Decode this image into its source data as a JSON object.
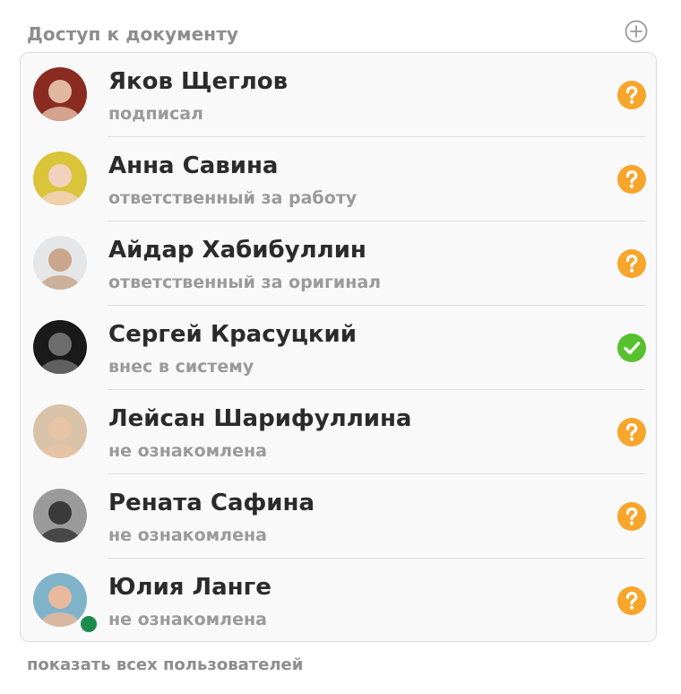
{
  "header": {
    "title": "Доступ к документу",
    "add_icon": "plus-circle-icon"
  },
  "members": [
    {
      "name": "Яков Щеглов",
      "role": "подписал",
      "status": "pending",
      "avatar_bg": "#8a2b22",
      "avatar_fg": "#e0b8a0"
    },
    {
      "name": "Анна Савина",
      "role": "ответственный за работу",
      "status": "pending",
      "avatar_bg": "#d9c43a",
      "avatar_fg": "#f2d2be"
    },
    {
      "name": "Айдар Хабибуллин",
      "role": "ответственный за оригинал",
      "status": "pending",
      "avatar_bg": "#e4e6e8",
      "avatar_fg": "#c9a68c"
    },
    {
      "name": "Сергей Красуцкий",
      "role": "внес в систему",
      "status": "done",
      "avatar_bg": "#1a1a1a",
      "avatar_fg": "#6d6d6d"
    },
    {
      "name": "Лейсан Шарифуллина",
      "role": "не ознакомлена",
      "status": "pending",
      "avatar_bg": "#d8c2a8",
      "avatar_fg": "#e9c3a6"
    },
    {
      "name": "Рената Сафина",
      "role": "не ознакомлена",
      "status": "pending",
      "avatar_bg": "#9a9a9a",
      "avatar_fg": "#3a3a3a"
    },
    {
      "name": "Юлия Ланге",
      "role": "не ознакомлена",
      "status": "pending",
      "avatar_bg": "#7fb3c9",
      "avatar_fg": "#e8b99c",
      "online": true
    }
  ],
  "status_colors": {
    "pending": "#f7a52b",
    "done": "#57c12d"
  },
  "status_icons": {
    "pending": "question-icon",
    "done": "check-icon"
  },
  "footer": {
    "show_all_label": "показать всех пользователей"
  }
}
